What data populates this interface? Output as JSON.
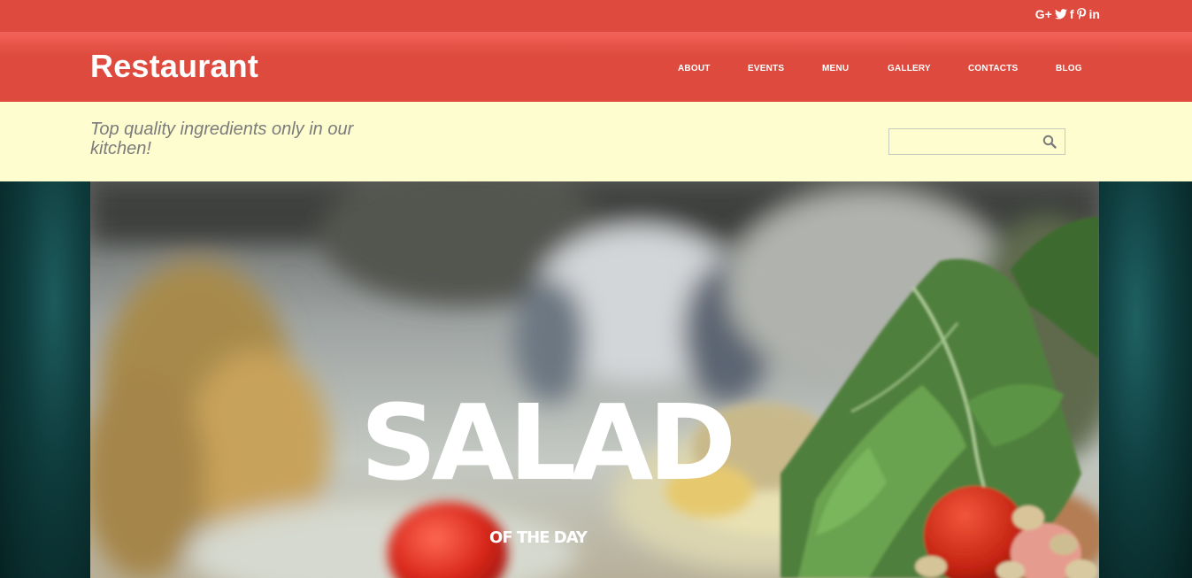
{
  "social": {
    "items": [
      {
        "icon": "google-plus-icon",
        "label": "G+"
      },
      {
        "icon": "twitter-icon"
      },
      {
        "icon": "facebook-icon",
        "label": "f"
      },
      {
        "icon": "pinterest-icon"
      },
      {
        "icon": "linkedin-icon",
        "label": "in"
      }
    ]
  },
  "header": {
    "logo": "Restaurant",
    "nav": [
      "ABOUT",
      "EVENTS",
      "MENU",
      "GALLERY",
      "CONTACTS",
      "BLOG"
    ]
  },
  "subheader": {
    "tagline": "Top quality ingredients only in our kitchen!",
    "search": {
      "value": "",
      "placeholder": "",
      "icon": "search-icon"
    }
  },
  "hero": {
    "title": "SALAD",
    "subtitle": "OF THE DAY"
  },
  "colors": {
    "brand_red": "#de4b3e",
    "cream": "#fefdd0",
    "teal_dark": "#0a2c2c"
  }
}
